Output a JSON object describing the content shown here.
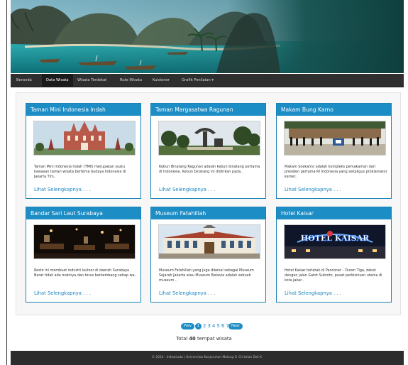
{
  "nav": {
    "items": [
      {
        "label": "Beranda",
        "active": false
      },
      {
        "label": "Data Wisata",
        "active": true
      },
      {
        "label": "Wisata Terdekat",
        "active": false
      },
      {
        "label": "Rute Wisata",
        "active": false
      },
      {
        "label": "Kuisioner",
        "active": false
      },
      {
        "label": "Grafik Penilaian",
        "active": false,
        "caret": "▾"
      }
    ]
  },
  "cards": [
    {
      "title": "Taman Mini Indonesia Indah",
      "description": "Taman Mini Indonesia Indah (TMII) merupakan suatu kawasan taman wisata bertema budaya Indonesia di Jakarta Tim..",
      "link": "Lihat Selengkapnya . . ."
    },
    {
      "title": "Taman Margasatwa Ragunan",
      "description": "Kebun Binatang Ragunan adalah kebun binatang pertama di Indonesia. Kebun binatang ini didirikan pada..",
      "link": "Lihat Selengkapnya . . ."
    },
    {
      "title": "Makam Bung Karno",
      "description": "Makam Soekarno adalah kompleks pemakaman dari presiden pertama RI Indonesia yang sekaligus proklamator kemer..",
      "link": "Lihat Selengkapnya . . ."
    },
    {
      "title": "Bandar Sari Laut Surabaya",
      "description": "Resto ini membuat industri kuliner di daerah Surabaya Barat tidak ada matinya dan terus berkembang setiap wa..",
      "link": "Lihat Selengkapnya . . ."
    },
    {
      "title": "Museum Fatahillah",
      "description": "Museum Fatahillah yang juga dikenal sebagai Museum Sejarah Jakarta atau Museum Batavia adalah sebuah museum ..",
      "link": "Lihat Selengkapnya . . ."
    },
    {
      "title": "Hotel Kaisar",
      "description": "Hotel Kaisar terletak di Pancoran - Duren Tiga, dekat dengan jalan Gatot Subroto, pusat perbisnisan utama di kota Jakar..",
      "link": "Lihat Selengkapnya . . ."
    }
  ],
  "images": {
    "hotel_sign": "HOTEL KAISAR"
  },
  "pagination": {
    "prev": "Prev",
    "current": "1",
    "pages": "2 3 4 5 6 7",
    "next": "Next"
  },
  "summary": {
    "prefix": "Total ",
    "count": "40",
    "suffix": " tempat wisata"
  },
  "footer": {
    "text": "© 2014 - Indowisata  |  Universitas Kanjuruhan Malang © Christian Dwi K."
  },
  "colors": {
    "accent": "#1d8dc6",
    "navbar": "#2f2f2f",
    "footer": "#2c2c2c"
  }
}
